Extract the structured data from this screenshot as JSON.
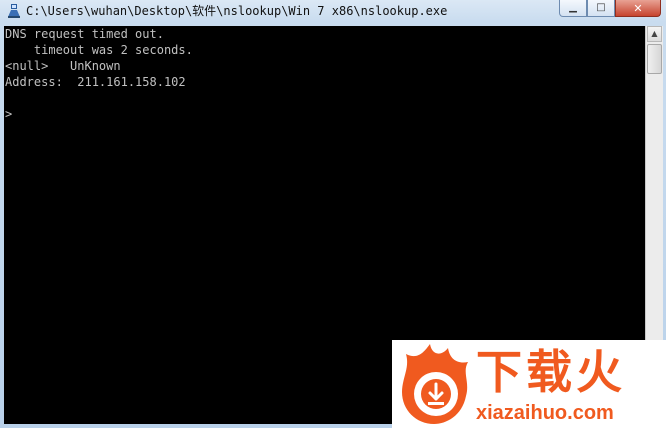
{
  "window": {
    "title": "C:\\Users\\wuhan\\Desktop\\软件\\nslookup\\Win 7 x86\\nslookup.exe",
    "icon": "console-app-icon",
    "controls": {
      "minimize": "▁",
      "maximize": "□",
      "close": "✕"
    }
  },
  "console": {
    "lines": [
      "DNS request timed out.",
      "    timeout was 2 seconds.",
      "<null>   UnKnown",
      "Address:  211.161.158.102",
      "",
      ">"
    ]
  },
  "scrollbar": {
    "up": "▲",
    "down": "▼"
  },
  "watermark": {
    "brand_cn": "下载火",
    "url": "xiazaihuo.com"
  },
  "colors": {
    "console_bg": "#000000",
    "console_text": "#c0c0c0",
    "brand": "#f05a1f"
  }
}
